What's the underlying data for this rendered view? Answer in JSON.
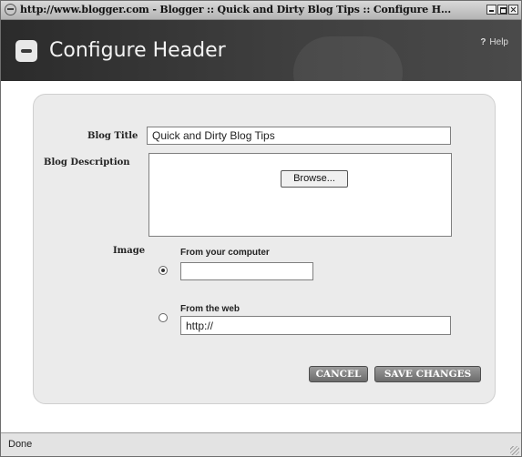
{
  "window": {
    "title": "http://www.blogger.com - Blogger :: Quick and Dirty Blog Tips :: Configure H..."
  },
  "header": {
    "title": "Configure Header",
    "help_label": "Help",
    "help_icon": "?"
  },
  "form": {
    "blog_title_label": "Blog Title",
    "blog_title_value": "Quick and Dirty Blog Tips",
    "blog_description_label": "Blog Description",
    "blog_description_value": "",
    "image_label": "Image",
    "from_computer_label": "From your computer",
    "from_computer_value": "",
    "from_computer_selected": true,
    "browse_label": "Browse...",
    "from_web_label": "From the web",
    "from_web_value": "http://"
  },
  "buttons": {
    "cancel": "CANCEL",
    "save": "SAVE CHANGES"
  },
  "statusbar": {
    "text": "Done"
  },
  "icons": {
    "browser": "ie-icon",
    "logo": "blogger-logo",
    "help": "help-icon"
  }
}
